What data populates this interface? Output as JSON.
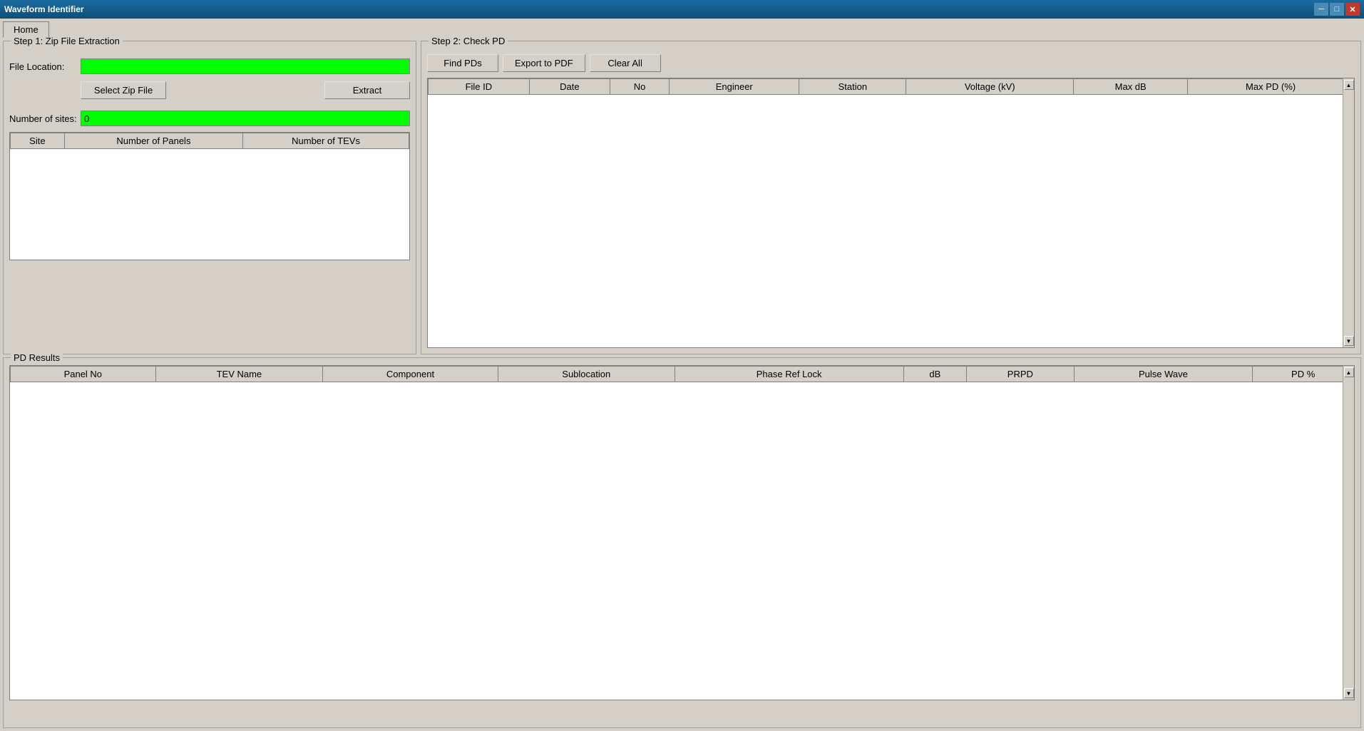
{
  "window": {
    "title": "Waveform Identifier",
    "minimize_label": "─",
    "maximize_label": "□",
    "close_label": "✕"
  },
  "tabs": [
    {
      "id": "home",
      "label": "Home",
      "active": true
    }
  ],
  "step1": {
    "group_label": "Step 1: Zip File Extraction",
    "file_location_label": "File Location:",
    "file_location_value": "",
    "select_zip_label": "Select Zip File",
    "extract_label": "Extract",
    "number_of_sites_label": "Number of sites:",
    "number_of_sites_value": "0",
    "sites_table": {
      "columns": [
        "Site",
        "Number of Panels",
        "Number of TEVs"
      ],
      "rows": []
    }
  },
  "step2": {
    "group_label": "Step 2: Check PD",
    "find_pds_label": "Find PDs",
    "export_to_pdf_label": "Export to PDF",
    "clear_all_label": "Clear All",
    "table": {
      "columns": [
        "File ID",
        "Date",
        "No",
        "Engineer",
        "Station",
        "Voltage (kV)",
        "Max dB",
        "Max PD (%)"
      ],
      "rows": []
    }
  },
  "pd_results": {
    "group_label": "PD Results",
    "table": {
      "columns": [
        "Panel No",
        "TEV Name",
        "Component",
        "Sublocation",
        "Phase Ref Lock",
        "dB",
        "PRPD",
        "Pulse Wave",
        "PD %"
      ],
      "rows": []
    }
  }
}
